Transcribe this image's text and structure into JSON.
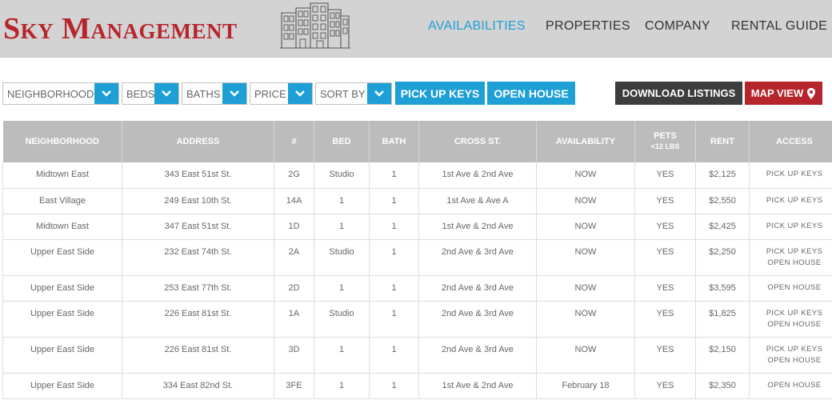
{
  "brand": {
    "name": "Sky Management"
  },
  "nav": [
    {
      "label": "AVAILABILITIES",
      "active": true
    },
    {
      "label": "PROPERTIES",
      "active": false
    },
    {
      "label": "COMPANY",
      "active": false
    },
    {
      "label": "RENTAL GUIDE",
      "active": false
    }
  ],
  "filters": [
    {
      "label": "NEIGHBORHOOD"
    },
    {
      "label": "BEDS"
    },
    {
      "label": "BATHS"
    },
    {
      "label": "PRICE"
    },
    {
      "label": "SORT BY"
    }
  ],
  "buttons": {
    "pick_up_keys": "PICK UP KEYS",
    "open_house": "OPEN HOUSE",
    "download_listings": "DOWNLOAD LISTINGS",
    "map_view": "MAP VIEW"
  },
  "table": {
    "headers": [
      "NEIGHBORHOOD",
      "ADDRESS",
      "#",
      "BED",
      "BATH",
      "CROSS ST.",
      "AVAILABILITY",
      "PETS",
      "RENT",
      "ACCESS"
    ],
    "pets_sub": "<12 LBS",
    "rows": [
      {
        "neighborhood": "Midtown East",
        "address": "343 East 51st St.",
        "unit": "2G",
        "bed": "Studio",
        "bath": "1",
        "cross": "1st Ave & 2nd Ave",
        "availability": "NOW",
        "pets": "YES",
        "rent": "$2,125",
        "access": [
          "PICK UP KEYS"
        ]
      },
      {
        "neighborhood": "East Village",
        "address": "249 East 10th St.",
        "unit": "14A",
        "bed": "1",
        "bath": "1",
        "cross": "1st Ave & Ave A",
        "availability": "NOW",
        "pets": "YES",
        "rent": "$2,550",
        "access": [
          "PICK UP KEYS"
        ]
      },
      {
        "neighborhood": "Midtown East",
        "address": "347 East 51st St.",
        "unit": "1D",
        "bed": "1",
        "bath": "1",
        "cross": "1st Ave & 2nd Ave",
        "availability": "NOW",
        "pets": "YES",
        "rent": "$2,425",
        "access": [
          "PICK UP KEYS"
        ]
      },
      {
        "neighborhood": "Upper East Side",
        "address": "232 East 74th St.",
        "unit": "2A",
        "bed": "Studio",
        "bath": "1",
        "cross": "2nd Ave & 3rd Ave",
        "availability": "NOW",
        "pets": "YES",
        "rent": "$2,250",
        "access": [
          "PICK UP KEYS",
          "OPEN HOUSE"
        ]
      },
      {
        "neighborhood": "Upper East Side",
        "address": "253 East 77th St.",
        "unit": "2D",
        "bed": "1",
        "bath": "1",
        "cross": "2nd Ave & 3rd Ave",
        "availability": "NOW",
        "pets": "YES",
        "rent": "$3,595",
        "access": [
          "OPEN HOUSE"
        ]
      },
      {
        "neighborhood": "Upper East Side",
        "address": "226 East 81st St.",
        "unit": "1A",
        "bed": "Studio",
        "bath": "1",
        "cross": "2nd Ave & 3rd Ave",
        "availability": "NOW",
        "pets": "YES",
        "rent": "$1,825",
        "access": [
          "PICK UP KEYS",
          "OPEN HOUSE"
        ]
      },
      {
        "neighborhood": "Upper East Side",
        "address": "226 East 81st St.",
        "unit": "3D",
        "bed": "1",
        "bath": "1",
        "cross": "2nd Ave & 3rd Ave",
        "availability": "NOW",
        "pets": "YES",
        "rent": "$2,150",
        "access": [
          "PICK UP KEYS",
          "OPEN HOUSE"
        ]
      },
      {
        "neighborhood": "Upper East Side",
        "address": "334 East 82nd St.",
        "unit": "3FE",
        "bed": "1",
        "bath": "1",
        "cross": "1st Ave & 2nd Ave",
        "availability": "February 18",
        "pets": "YES",
        "rent": "$2,350",
        "access": [
          "OPEN HOUSE"
        ]
      }
    ]
  },
  "colors": {
    "accent": "#1e9fd6",
    "brand": "#b5252b",
    "header_bg": "#d3d3d3",
    "dark_button": "#3d3d3d"
  },
  "icons": {
    "dropdown": "chevron-down-icon",
    "row_action": "chevron-right-icon",
    "map": "map-pin-icon",
    "logo": "building-sketch-icon"
  }
}
